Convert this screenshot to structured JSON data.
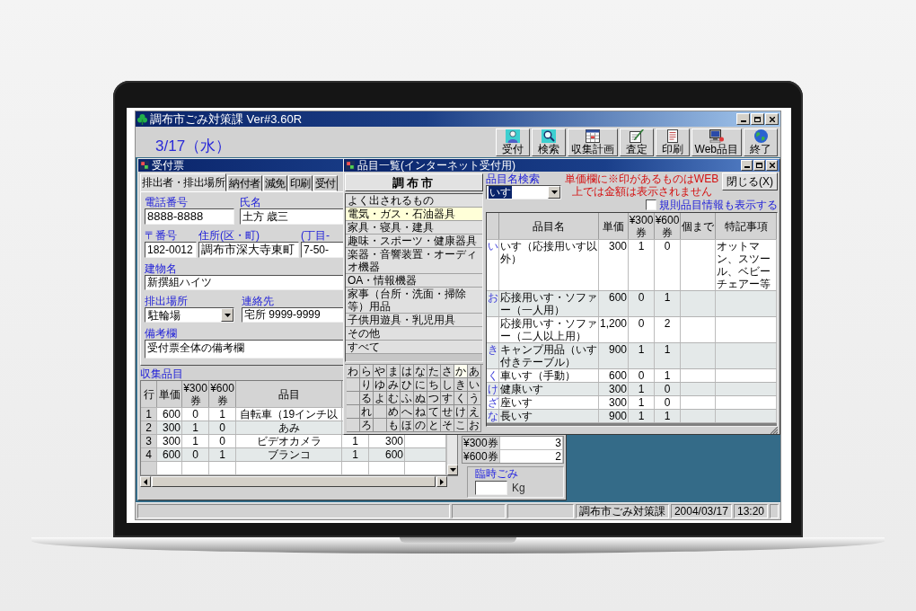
{
  "window": {
    "title": "調布市ごみ対策課 Ver#3.60R"
  },
  "toolbar": {
    "date": "3/17（水）",
    "buttons": [
      {
        "label": "受付",
        "kind": "reception"
      },
      {
        "label": "検索",
        "kind": "search"
      },
      {
        "label": "収集計画",
        "kind": "plan"
      },
      {
        "label": "査定",
        "kind": "assessment"
      },
      {
        "label": "印刷",
        "kind": "print"
      },
      {
        "label": "Web品目",
        "kind": "web"
      },
      {
        "label": "終了",
        "kind": "exit"
      }
    ]
  },
  "reception_form": {
    "title": "受付票",
    "tabs": [
      {
        "label": "排出者・排出場所",
        "selected": true
      },
      {
        "label": "納付者",
        "selected": false
      },
      {
        "label": "減免",
        "selected": false
      },
      {
        "label": "印刷",
        "selected": false
      },
      {
        "label": "受付",
        "selected": false
      }
    ],
    "field_rows": [
      {
        "fields": [
          {
            "label": "電話番号",
            "value": "8888-8888",
            "kind": "text"
          },
          {
            "label": "氏名",
            "value": "土方 歳三",
            "kind": "text"
          }
        ]
      },
      {
        "fields": [
          {
            "label": "〒番号",
            "value": "182-0012",
            "kind": "text"
          },
          {
            "label": "住所(区・町)",
            "value": "調布市深大寺東町",
            "kind": "text"
          },
          {
            "label": "(丁目-",
            "value": "7-50-",
            "kind": "text"
          }
        ]
      },
      {
        "fields": [
          {
            "label": "建物名",
            "value": "新撰組ハイツ",
            "kind": "text"
          }
        ]
      },
      {
        "fields": [
          {
            "label": "排出場所",
            "value": "駐輪場",
            "kind": "select"
          },
          {
            "label": "連絡先",
            "value": "宅所 9999-9999",
            "kind": "text"
          }
        ]
      },
      {
        "fields": [
          {
            "label": "備考欄",
            "value": "受付票全体の備考欄",
            "kind": "memo"
          }
        ]
      }
    ],
    "items_label": "収集品目",
    "items_table": {
      "columns": [
        "行",
        "単価",
        "¥300券",
        "¥600券",
        "品目"
      ],
      "rows": [
        {
          "no": "1",
          "price": "600",
          "ticket300": "0",
          "ticket600": "1",
          "item": "自転車（19インチ以"
        },
        {
          "no": "2",
          "price": "300",
          "ticket300": "1",
          "ticket600": "0",
          "item": "あみ"
        },
        {
          "no": "3",
          "price": "300",
          "ticket300": "1",
          "ticket600": "0",
          "item": "ビデオカメラ",
          "quantity": "1",
          "amount": "300"
        },
        {
          "no": "4",
          "price": "600",
          "ticket300": "0",
          "ticket600": "1",
          "item": "ブランコ",
          "quantity": "1",
          "amount": "600"
        }
      ]
    },
    "ticket_totals": [
      {
        "label": "¥300券",
        "value": "3"
      },
      {
        "label": "¥600券",
        "value": "2"
      }
    ],
    "temporary_waste": {
      "label": "臨時ごみ",
      "unit": "Kg"
    }
  },
  "item_list": {
    "title": "品目一覧(インターネット受付用)",
    "city_button": "調布市",
    "categories": [
      {
        "label": "よく出されるもの",
        "selected": false
      },
      {
        "label": "電気・ガス・石油器具",
        "selected": true
      },
      {
        "label": "家具・寝具・建具",
        "selected": false
      },
      {
        "label": "趣味・スポーツ・健康器具",
        "selected": false
      },
      {
        "label": "楽器・音響装置・オーディオ機器",
        "selected": false
      },
      {
        "label": "OA・情報機器",
        "selected": false
      },
      {
        "label": "家事（台所・洗面・掃除等）用品",
        "selected": false
      },
      {
        "label": "子供用遊具・乳児用具",
        "selected": false
      },
      {
        "label": "その他",
        "selected": false
      },
      {
        "label": "すべて",
        "selected": false
      }
    ],
    "kana_columns": [
      {
        "chars": [
          {
            "char": "わ",
            "selected": false
          }
        ]
      },
      {
        "chars": [
          {
            "char": "ら",
            "selected": false
          },
          {
            "char": "り",
            "selected": false
          },
          {
            "char": "る",
            "selected": false
          },
          {
            "char": "れ",
            "selected": false
          },
          {
            "char": "ろ",
            "selected": false
          }
        ]
      },
      {
        "chars": [
          {
            "char": "や",
            "selected": false
          },
          {
            "char": "ゆ",
            "selected": false
          },
          {
            "char": "よ",
            "selected": false
          }
        ]
      },
      {
        "chars": [
          {
            "char": "ま",
            "selected": false
          },
          {
            "char": "み",
            "selected": false
          },
          {
            "char": "む",
            "selected": false
          },
          {
            "char": "め",
            "selected": false
          },
          {
            "char": "も",
            "selected": false
          }
        ]
      },
      {
        "chars": [
          {
            "char": "は",
            "selected": false
          },
          {
            "char": "ひ",
            "selected": false
          },
          {
            "char": "ふ",
            "selected": false
          },
          {
            "char": "へ",
            "selected": false
          },
          {
            "char": "ほ",
            "selected": false
          }
        ]
      },
      {
        "chars": [
          {
            "char": "な",
            "selected": false
          },
          {
            "char": "に",
            "selected": false
          },
          {
            "char": "ぬ",
            "selected": false
          },
          {
            "char": "ね",
            "selected": false
          },
          {
            "char": "の",
            "selected": false
          }
        ]
      },
      {
        "chars": [
          {
            "char": "た",
            "selected": false
          },
          {
            "char": "ち",
            "selected": false
          },
          {
            "char": "つ",
            "selected": false
          },
          {
            "char": "て",
            "selected": false
          },
          {
            "char": "と",
            "selected": false
          }
        ]
      },
      {
        "chars": [
          {
            "char": "さ",
            "selected": false
          },
          {
            "char": "し",
            "selected": false
          },
          {
            "char": "す",
            "selected": false
          },
          {
            "char": "せ",
            "selected": false
          },
          {
            "char": "そ",
            "selected": false
          }
        ]
      },
      {
        "chars": [
          {
            "char": "か",
            "selected": true
          },
          {
            "char": "き",
            "selected": false
          },
          {
            "char": "く",
            "selected": false
          },
          {
            "char": "け",
            "selected": false
          },
          {
            "char": "こ",
            "selected": false
          }
        ]
      },
      {
        "chars": [
          {
            "char": "あ",
            "selected": false
          },
          {
            "char": "い",
            "selected": false
          },
          {
            "char": "う",
            "selected": false
          },
          {
            "char": "え",
            "selected": false
          },
          {
            "char": "お",
            "selected": false
          }
        ]
      }
    ],
    "search": {
      "label": "品目名検索",
      "value": "いす"
    },
    "notice": "単価欄に※印があるものはWEB上では金額は表示されません",
    "close_button": "閉じる(X)",
    "show_rules": {
      "label": "規則品目情報も表示する",
      "checked": false
    },
    "columns": [
      "品目名",
      "単価",
      "¥300券",
      "¥600券",
      "個まで",
      "特記事項"
    ],
    "rows": [
      {
        "index": "い",
        "name": "いす（応接用いす以外）",
        "price": "300",
        "ticket300": "1",
        "ticket600": "0",
        "note": "オットマン、スツール、ベビーチェアー等"
      },
      {
        "index": "お",
        "name": "応接用いす・ソファー（一人用）",
        "price": "600",
        "ticket300": "0",
        "ticket600": "1"
      },
      {
        "name": "応接用いす・ソファー（二人以上用）",
        "price": "1,200",
        "ticket300": "0",
        "ticket600": "2"
      },
      {
        "index": "き",
        "name": "キャンプ用品（いす付きテーブル）",
        "price": "900",
        "ticket300": "1",
        "ticket600": "1"
      },
      {
        "index": "く",
        "name": "車いす（手動）",
        "price": "600",
        "ticket300": "0",
        "ticket600": "1"
      },
      {
        "index": "け",
        "name": "健康いす",
        "price": "300",
        "ticket300": "1",
        "ticket600": "0"
      },
      {
        "index": "ざ",
        "name": "座いす",
        "price": "300",
        "ticket300": "1",
        "ticket600": "0"
      },
      {
        "index": "な",
        "name": "長いす",
        "price": "900",
        "ticket300": "1",
        "ticket600": "1"
      }
    ]
  },
  "status_bar": {
    "panes": [
      "調布市ごみ対策課",
      "2004/03/17",
      "13:20"
    ]
  }
}
